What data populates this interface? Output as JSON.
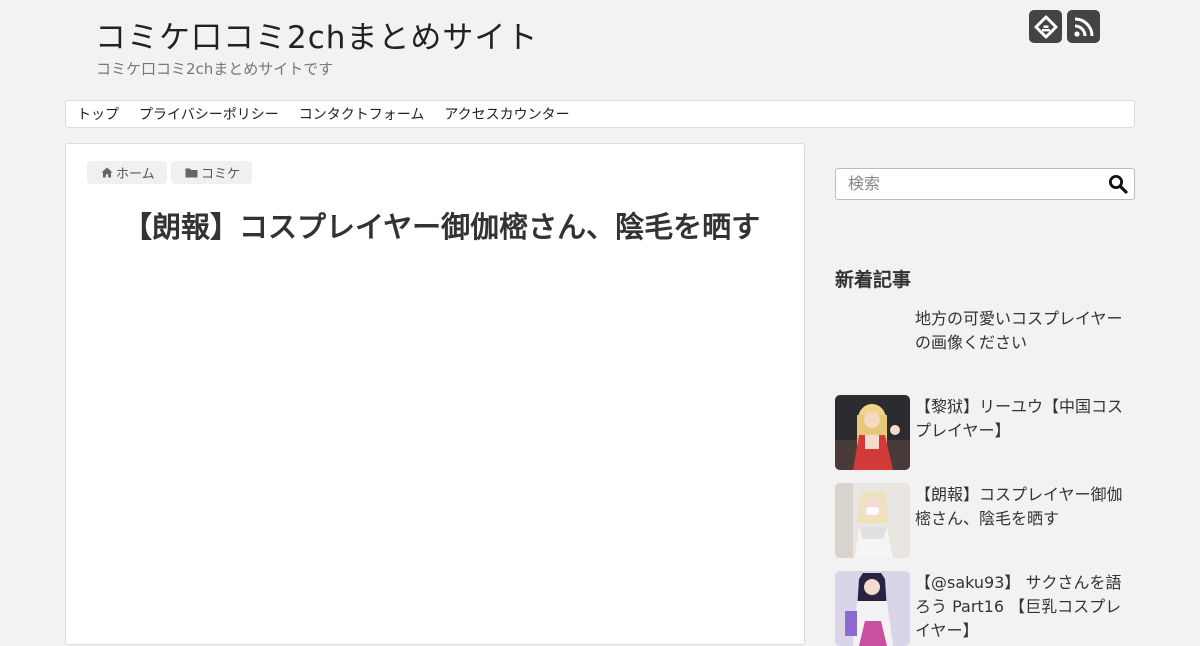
{
  "header": {
    "site_title": "コミケ口コミ2chまとめサイト",
    "site_description": "コミケ口コミ2chまとめサイトです",
    "social": [
      {
        "name": "feedly-icon",
        "color": "#444444"
      },
      {
        "name": "rss-icon",
        "color": "#444444"
      }
    ]
  },
  "nav": {
    "items": [
      {
        "label": "トップ"
      },
      {
        "label": "プライバシーポリシー"
      },
      {
        "label": "コンタクトフォーム"
      },
      {
        "label": "アクセスカウンター"
      }
    ]
  },
  "breadcrumb": {
    "home_label": "ホーム",
    "category_label": "コミケ",
    "icons": [
      "home-icon",
      "folder-icon"
    ]
  },
  "article": {
    "title": "【朗報】コスプレイヤー御伽樒さん、陰毛を晒す"
  },
  "sidebar": {
    "search_placeholder": "検索",
    "search_icon": "search-icon",
    "recent_title": "新着記事",
    "recent_posts": [
      {
        "title": "地方の可愛いコスプレイヤーの画像ください"
      },
      {
        "title": "【黎狱】リーユウ【中国コスプレイヤー】"
      },
      {
        "title": "【朗報】コスプレイヤー御伽樒さん、陰毛を晒す"
      },
      {
        "title": "【@saku93】 サクさんを語ろう Part16 【巨乳コスプレイヤー】"
      }
    ]
  },
  "colors": {
    "background": "#f2f2f2",
    "social_icon_bg": "#444444",
    "text": "#333333",
    "muted": "#777777"
  }
}
